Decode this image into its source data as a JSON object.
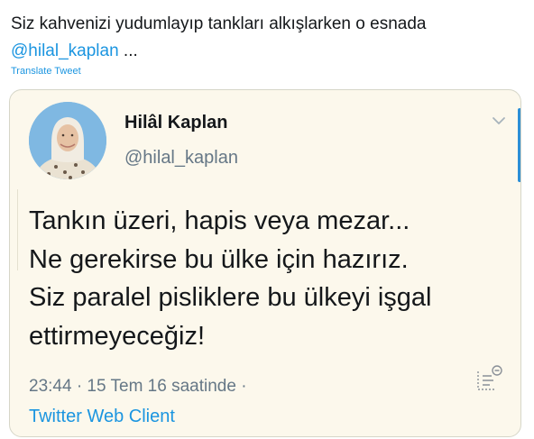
{
  "tweet": {
    "text": "Siz kahvenizi yudumlayıp tankları alkışlarken o esnada",
    "mention": "@hilal_kaplan",
    "ellipsis": " ...",
    "translate_label": "Translate Tweet"
  },
  "quote": {
    "avatar_icon": "user-avatar",
    "display_name": "Hilâl Kaplan",
    "handle": "@hilal_kaplan",
    "chevron_icon": "chevron-down-icon",
    "body_lines": [
      "Tankın üzeri, hapis veya mezar...",
      "Ne gerekirse bu ülke için hazırız.",
      "Siz paralel pisliklere bu ülkeyi işgal",
      "ettirmeyeceğiz!"
    ],
    "timestamp": "23:44 · 15 Tem 16 saatinde ·",
    "client": "Twitter Web Client",
    "menu_icon": "document-menu-icon"
  },
  "colors": {
    "link": "#1b95e0",
    "card_background": "#fcf8ec",
    "muted_text": "#657786"
  }
}
